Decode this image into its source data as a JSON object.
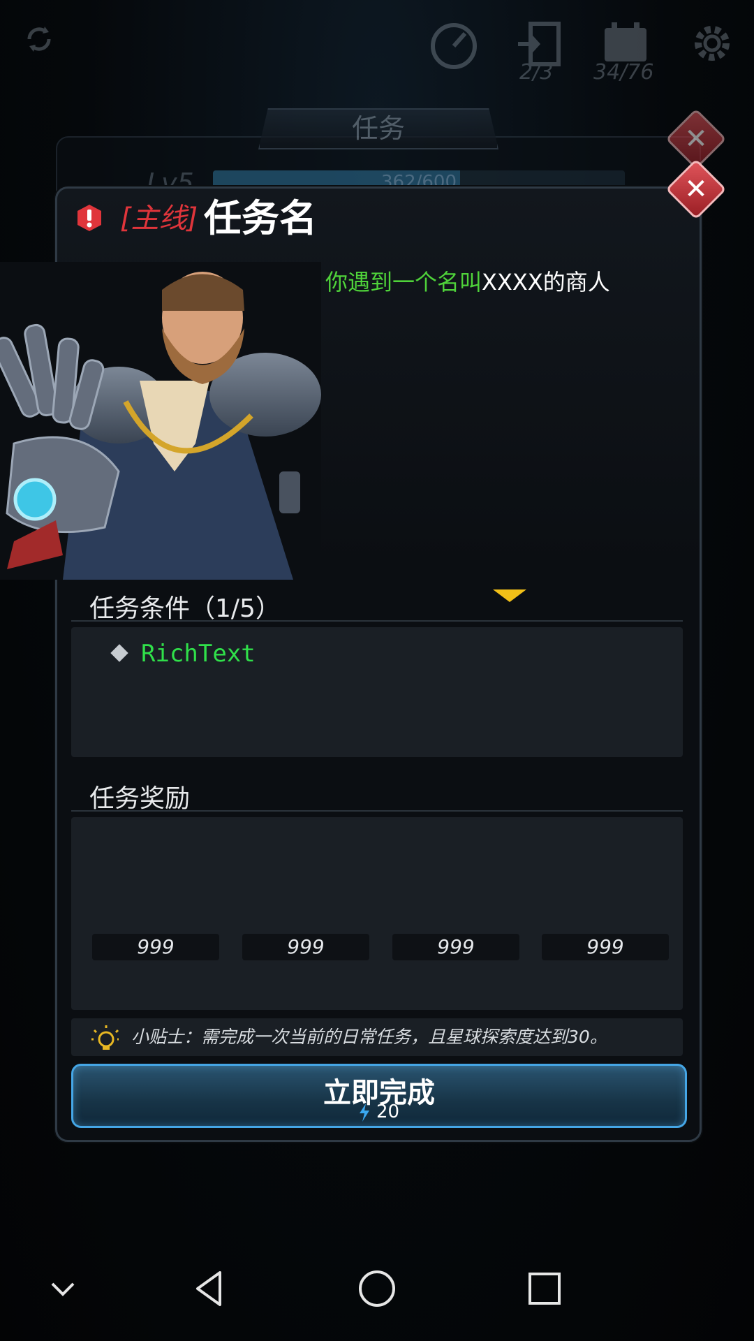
{
  "hud": {
    "counter_left": "2/3",
    "counter_right": "34/76",
    "icons": [
      "refresh-icon",
      "timer-icon",
      "exit-door-icon",
      "calendar-icon",
      "gear-icon"
    ]
  },
  "back_panel": {
    "title": "任务",
    "level": "Lv5",
    "progress_text": "362/600",
    "progress_value": 0.6
  },
  "quest": {
    "tag": "[主线]",
    "name": "任务名",
    "description_highlight": "你遇到一个名叫",
    "description_rest": "XXXX的商人"
  },
  "conditions": {
    "title": "任务条件（1/5）",
    "items": [
      "RichText"
    ]
  },
  "rewards": {
    "title": "任务奖励",
    "slots": [
      "999",
      "999",
      "999",
      "999"
    ]
  },
  "tip": {
    "text": "小贴士：需完成一次当前的日常任务，且星球探索度达到30。"
  },
  "action": {
    "label": "立即完成",
    "cost": "20"
  },
  "colors": {
    "tag_red": "#e0353b",
    "desc_green": "#4fd33a",
    "cond_green": "#30e04a",
    "button_blue": "#45a6e6",
    "arrow_yellow": "#f2c018"
  }
}
